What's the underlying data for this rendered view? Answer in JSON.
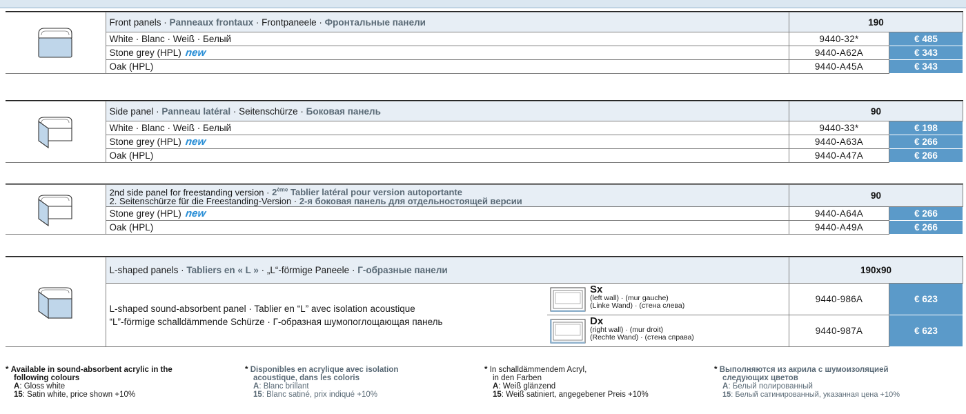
{
  "sections": [
    {
      "header": {
        "en": "Front panels",
        "fr": "Panneaux frontaux",
        "de": "Frontpaneele",
        "ru": "Фронтальные панели"
      },
      "size": "190",
      "rows": [
        {
          "label": "White · Blanc · Weiß · Белый",
          "code": "9440-32*",
          "price": "€ 485",
          "new": false
        },
        {
          "label": "Stone grey (HPL)",
          "code": "9440-A62A",
          "price": "€ 343",
          "new": true
        },
        {
          "label": "Oak (HPL)",
          "code": "9440-A45A",
          "price": "€ 343",
          "new": false
        }
      ]
    },
    {
      "header": {
        "en": "Side panel",
        "fr": "Panneau latéral",
        "de": "Seitenschürze",
        "ru": "Боковая панель"
      },
      "size": "90",
      "rows": [
        {
          "label": "White · Blanc · Weiß · Белый",
          "code": "9440-33*",
          "price": "€ 198",
          "new": false
        },
        {
          "label": "Stone grey (HPL)",
          "code": "9440-A63A",
          "price": "€ 266",
          "new": true
        },
        {
          "label": "Oak (HPL)",
          "code": "9440-A47A",
          "price": "€ 266",
          "new": false
        }
      ]
    },
    {
      "header": {
        "line1_en": "2nd side panel for freestanding version",
        "line1_fr_sup": "ème",
        "line1_fr_pre": "2",
        "line1_fr": "Tablier latéral pour version autoportante",
        "line2_de": "2. Seitenschürze für die Freestanding-Version",
        "line2_ru": "2-я боковая панель для отдельностоящей версии"
      },
      "size": "90",
      "rows": [
        {
          "label": "Stone grey (HPL)",
          "code": "9440-A64A",
          "price": "€ 266",
          "new": true
        },
        {
          "label": "Oak (HPL)",
          "code": "9440-A49A",
          "price": "€ 266",
          "new": false
        }
      ]
    },
    {
      "header": {
        "en": "L-shaped panels",
        "fr": "Tabliers en « L »",
        "de": "„L“-förmige Paneele",
        "ru": "Г-образные панели"
      },
      "size": "190x90",
      "desc_line1": "L-shaped sound-absorbent panel · Tablier en “L” avec isolation acoustique",
      "desc_line2": "“L”-förmige schalldämmende Schürze · Г-образная шумопоглощающая панель",
      "variants": [
        {
          "name": "Sx",
          "line1": "(left wall) · (mur gauche)",
          "line2": "(Linke Wand) · (стена слева)",
          "code": "9440-986A",
          "price": "€ 623"
        },
        {
          "name": "Dx",
          "line1": "(right wall) · (mur droit)",
          "line2": "(Rechte Wand) · (стена справа)",
          "code": "9440-987A",
          "price": "€ 623"
        }
      ]
    }
  ],
  "new_badge": "new",
  "notes": [
    {
      "star": "*",
      "title1": "Available in sound-absorbent acrylic in the",
      "title2": "following colours",
      "a_label": "A",
      "a_text": ": Gloss white",
      "b_label": "15",
      "b_text": ": Satin white, price shown +10%"
    },
    {
      "star": "*",
      "title1": "Disponibles en acrylique avec isolation",
      "title2": "acoustique, dans les coloris",
      "a_label": "A",
      "a_text": ": Blanc brillant",
      "b_label": "15",
      "b_text": ": Blanc satiné, prix indiqué +10%"
    },
    {
      "star": "*",
      "title1": "In schalldämmendem Acryl,",
      "title2": "in den Farben",
      "a_label": "A",
      "a_text": ": Weiß glänzend",
      "b_label": "15",
      "b_text": ": Weiß satiniert, angegebener Preis +10%"
    },
    {
      "star": "*",
      "title1": "Выполняются из акрила с шумоизоляцией",
      "title2": "следующих цветов",
      "a_label": "A",
      "a_text": ": Белый полированный",
      "b_label": "15",
      "b_text": ": Белый сатинированный, указанная цена +10%"
    }
  ],
  "colors": {
    "price_bg": "#5b9ac9",
    "header_bg": "#e7eef5",
    "accent_text": "#5a6a76",
    "new_badge": "#2b8fd6"
  }
}
